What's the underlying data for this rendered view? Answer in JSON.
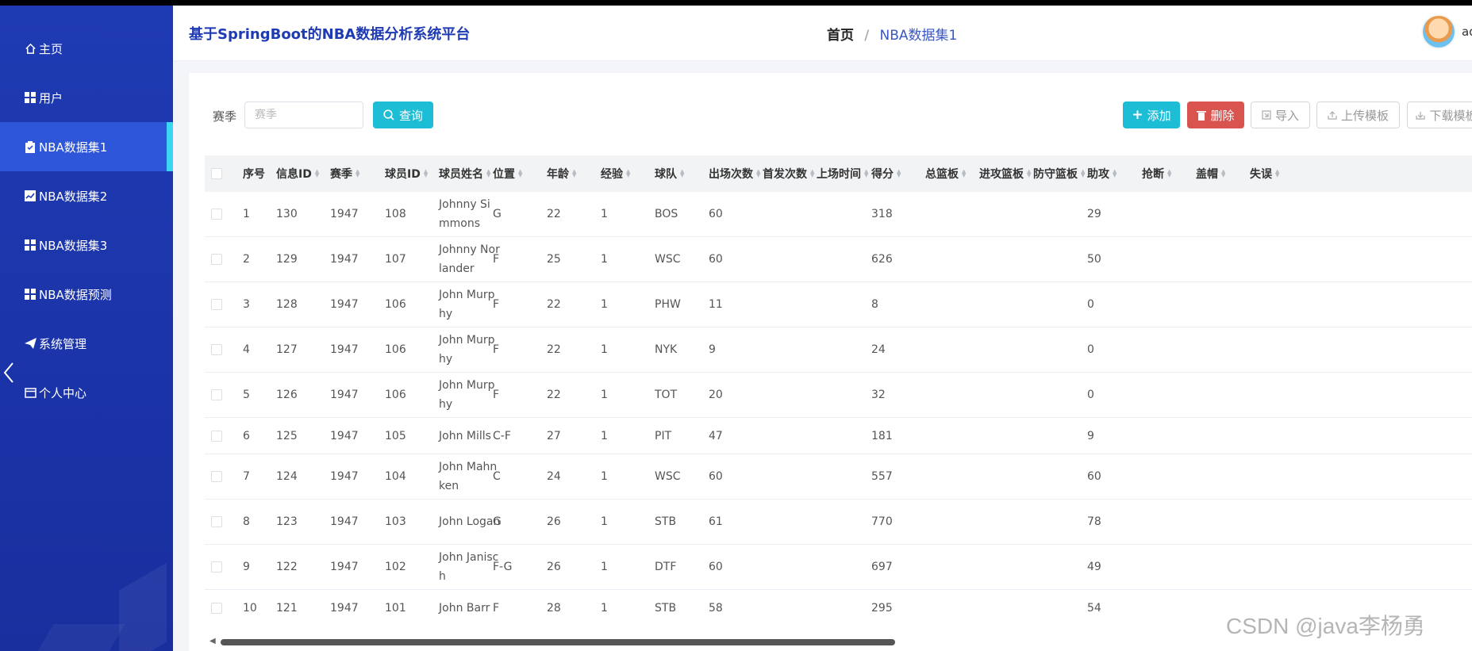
{
  "app": {
    "title": "基于SpringBoot的NBA数据分析系统平台",
    "user": "ad"
  },
  "breadcrumb": {
    "home": "首页",
    "separator": "/",
    "current": "NBA数据集1"
  },
  "sidebar": {
    "items": [
      {
        "label": "主页",
        "icon": "home-icon"
      },
      {
        "label": "用户",
        "icon": "grid-icon"
      },
      {
        "label": "NBA数据集1",
        "icon": "clipboard-icon",
        "active": true
      },
      {
        "label": "NBA数据集2",
        "icon": "chart-icon"
      },
      {
        "label": "NBA数据集3",
        "icon": "grid-icon"
      },
      {
        "label": "NBA数据预测",
        "icon": "grid-icon"
      },
      {
        "label": "系统管理",
        "icon": "send-icon"
      },
      {
        "label": "个人中心",
        "icon": "card-icon"
      }
    ]
  },
  "filter": {
    "label": "赛季",
    "placeholder": "赛季",
    "query_label": "查询"
  },
  "toolbar": {
    "add_label": "添加",
    "delete_label": "删除",
    "import_label": "导入",
    "upload_label": "上传模板",
    "download_label": "下载模板"
  },
  "table": {
    "columns": [
      "序号",
      "信息ID",
      "赛季",
      "球员ID",
      "球员姓名",
      "位置",
      "年龄",
      "经验",
      "球队",
      "出场次数",
      "首发次数",
      "上场时间",
      "得分",
      "总篮板",
      "进攻篮板",
      "防守篮板",
      "助攻",
      "抢断",
      "盖帽",
      "失误"
    ],
    "rows": [
      {
        "no": "1",
        "info_id": "130",
        "season": "1947",
        "player_id": "108",
        "name": "Johnny Simmons",
        "pos": "G",
        "age": "22",
        "exp": "1",
        "team": "BOS",
        "games": "60",
        "points": "318",
        "assists": "29"
      },
      {
        "no": "2",
        "info_id": "129",
        "season": "1947",
        "player_id": "107",
        "name": "Johnny Norlander",
        "pos": "F",
        "age": "25",
        "exp": "1",
        "team": "WSC",
        "games": "60",
        "points": "626",
        "assists": "50"
      },
      {
        "no": "3",
        "info_id": "128",
        "season": "1947",
        "player_id": "106",
        "name": "John Murphy",
        "pos": "F",
        "age": "22",
        "exp": "1",
        "team": "PHW",
        "games": "11",
        "points": "8",
        "assists": "0"
      },
      {
        "no": "4",
        "info_id": "127",
        "season": "1947",
        "player_id": "106",
        "name": "John Murphy",
        "pos": "F",
        "age": "22",
        "exp": "1",
        "team": "NYK",
        "games": "9",
        "points": "24",
        "assists": "0"
      },
      {
        "no": "5",
        "info_id": "126",
        "season": "1947",
        "player_id": "106",
        "name": "John Murphy",
        "pos": "F",
        "age": "22",
        "exp": "1",
        "team": "TOT",
        "games": "20",
        "points": "32",
        "assists": "0"
      },
      {
        "no": "6",
        "info_id": "125",
        "season": "1947",
        "player_id": "105",
        "name": "John Mills",
        "pos": "C-F",
        "age": "27",
        "exp": "1",
        "team": "PIT",
        "games": "47",
        "points": "181",
        "assists": "9"
      },
      {
        "no": "7",
        "info_id": "124",
        "season": "1947",
        "player_id": "104",
        "name": "John Mahnken",
        "pos": "C",
        "age": "24",
        "exp": "1",
        "team": "WSC",
        "games": "60",
        "points": "557",
        "assists": "60"
      },
      {
        "no": "8",
        "info_id": "123",
        "season": "1947",
        "player_id": "103",
        "name": "John Logan",
        "pos": "G",
        "age": "26",
        "exp": "1",
        "team": "STB",
        "games": "61",
        "points": "770",
        "assists": "78"
      },
      {
        "no": "9",
        "info_id": "122",
        "season": "1947",
        "player_id": "102",
        "name": "John Janisch",
        "pos": "F-G",
        "age": "26",
        "exp": "1",
        "team": "DTF",
        "games": "60",
        "points": "697",
        "assists": "49"
      },
      {
        "no": "10",
        "info_id": "121",
        "season": "1947",
        "player_id": "101",
        "name": "John Barr",
        "pos": "F",
        "age": "28",
        "exp": "1",
        "team": "STB",
        "games": "58",
        "points": "295",
        "assists": "54"
      }
    ]
  },
  "watermark": "CSDN @java李杨勇",
  "colors": {
    "sidebar": "#1f3bb3",
    "active": "#2d56d8",
    "accent": "#1dbdd6",
    "danger": "#d9534f"
  }
}
